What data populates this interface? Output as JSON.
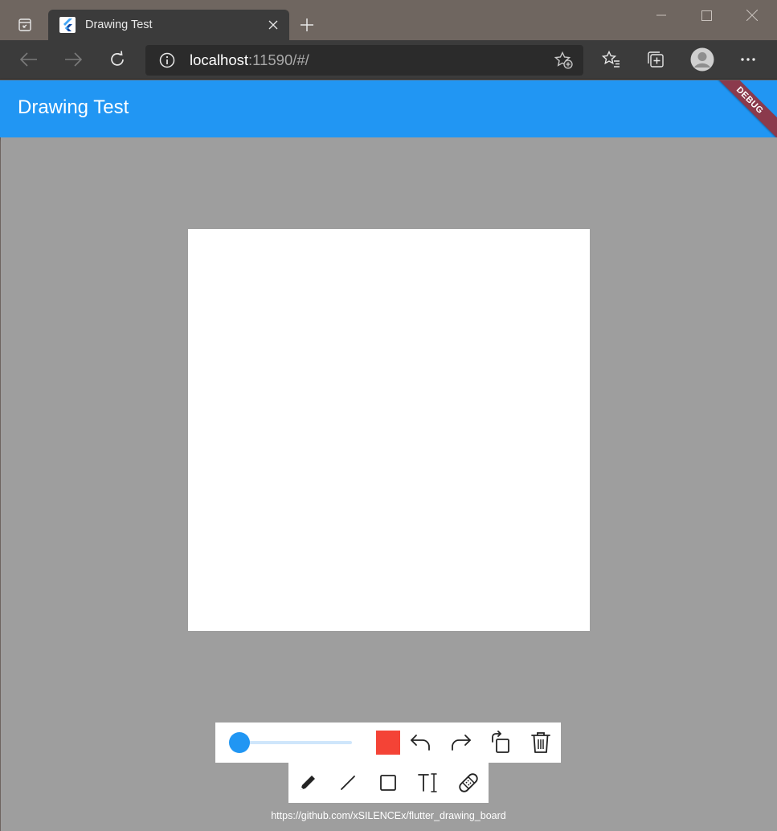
{
  "browser": {
    "tab_title": "Drawing Test",
    "address_host": "localhost",
    "address_rest": ":11590/#/"
  },
  "app": {
    "title": "Drawing Test",
    "debug_banner": "DEBUG",
    "stroke_width_value": 0,
    "selected_color": "#f44336",
    "accent": "#2196f3",
    "canvas_background": "#ffffff",
    "workspace_background": "#9e9e9e"
  },
  "controls": {
    "icons": [
      "undo-icon",
      "redo-icon",
      "rotate-icon",
      "delete-icon"
    ]
  },
  "tools": {
    "icons": [
      "pen-icon",
      "line-icon",
      "rectangle-icon",
      "text-icon",
      "eraser-icon"
    ]
  },
  "footer": {
    "link": "https://github.com/xSILENCEx/flutter_drawing_board"
  }
}
